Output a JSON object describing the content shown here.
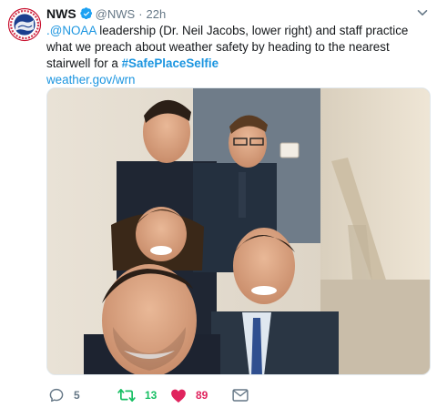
{
  "tweet": {
    "author_name": "NWS",
    "handle": "@NWS",
    "separator": "·",
    "timestamp": "22h",
    "text_mention": ".@NOAA",
    "text_body": " leadership (Dr. Neil Jacobs, lower right) and staff practice what we preach about weather safety by heading to the nearest stairwell for a ",
    "hashtag": "#SafePlaceSelfie",
    "link": "weather.gov/wrn",
    "avatar_icon": "nws-logo-icon",
    "verified_icon": "verified-badge-icon",
    "more_icon": "chevron-down-icon"
  },
  "actions": {
    "reply_count": "5",
    "retweet_count": "13",
    "like_count": "89"
  },
  "colors": {
    "link": "#1b95e0",
    "retweet_active": "#17bf63",
    "like_active": "#e0245e",
    "muted": "#657786"
  }
}
